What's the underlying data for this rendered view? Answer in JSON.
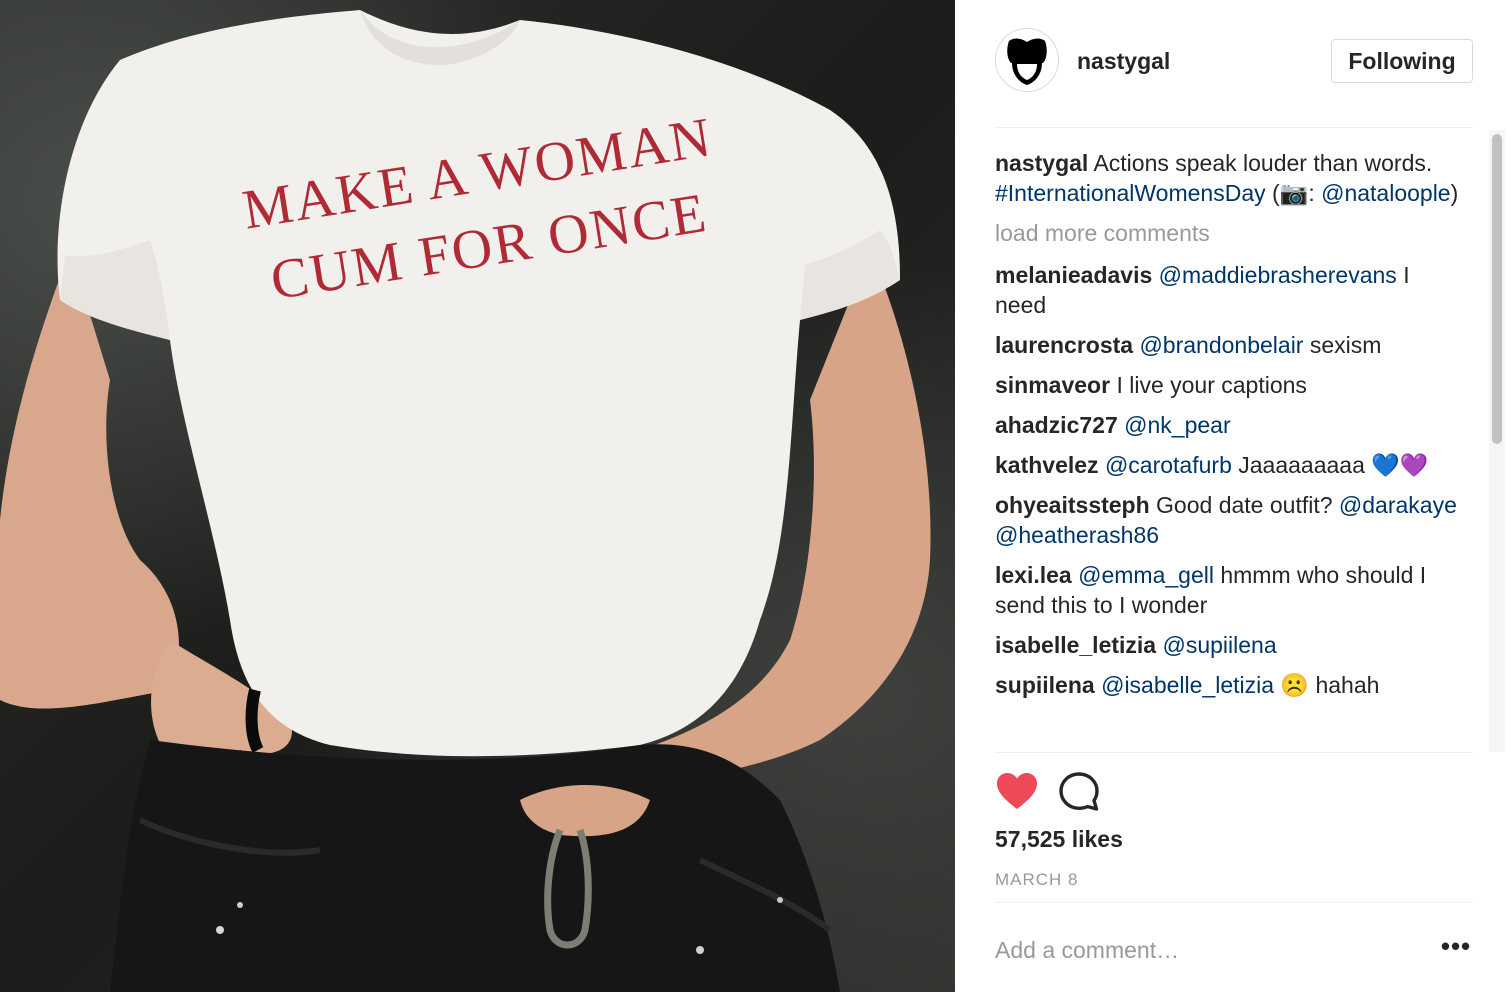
{
  "post": {
    "shirt_text_line1": "MAKE A WOMAN",
    "shirt_text_line2": "CUM FOR ONCE"
  },
  "header": {
    "username": "nastygal",
    "follow_label": "Following",
    "avatar_icon": "lips-logo-icon"
  },
  "caption": {
    "user": "nastygal",
    "text_1": " Actions speak louder than words. ",
    "hashtag": "#InternationalWomensDay",
    "text_2": " (",
    "camera_emoji": "📷",
    "text_3": ": ",
    "mention": "@nataloople",
    "text_4": ")"
  },
  "load_more": "load more comments",
  "comments": [
    {
      "user": "melanieadavis",
      "mention": "@maddiebrasherevans",
      "text": " I need"
    },
    {
      "user": "laurencrosta",
      "mention": "@brandonbelair",
      "text": " sexism"
    },
    {
      "user": "sinmaveor",
      "text": " I live your captions"
    },
    {
      "user": "ahadzic727",
      "mention": "@nk_pear",
      "text": ""
    },
    {
      "user": "kathvelez",
      "mention": "@carotafurb",
      "text": " Jaaaaaaaaa 💙💜"
    },
    {
      "user": "ohyeaitssteph",
      "text": " Good date outfit? ",
      "mention": "@darakaye",
      "mention2": "@heatherash86"
    },
    {
      "user": "lexi.lea",
      "mention": "@emma_gell",
      "text": " hmmm who should I send this to I wonder"
    },
    {
      "user": "isabelle_letizia",
      "mention": "@supiilena",
      "text": ""
    },
    {
      "user": "supiilena",
      "mention": "@isabelle_letizia",
      "text": " ☹️ hahah"
    }
  ],
  "actions": {
    "like_icon": "heart-filled-icon",
    "comment_icon": "comment-bubble-icon",
    "like_color": "#ed4956"
  },
  "likes": "57,525 likes",
  "date": "MARCH 8",
  "add_comment": {
    "placeholder": "Add a comment…",
    "more_label": "•••"
  }
}
